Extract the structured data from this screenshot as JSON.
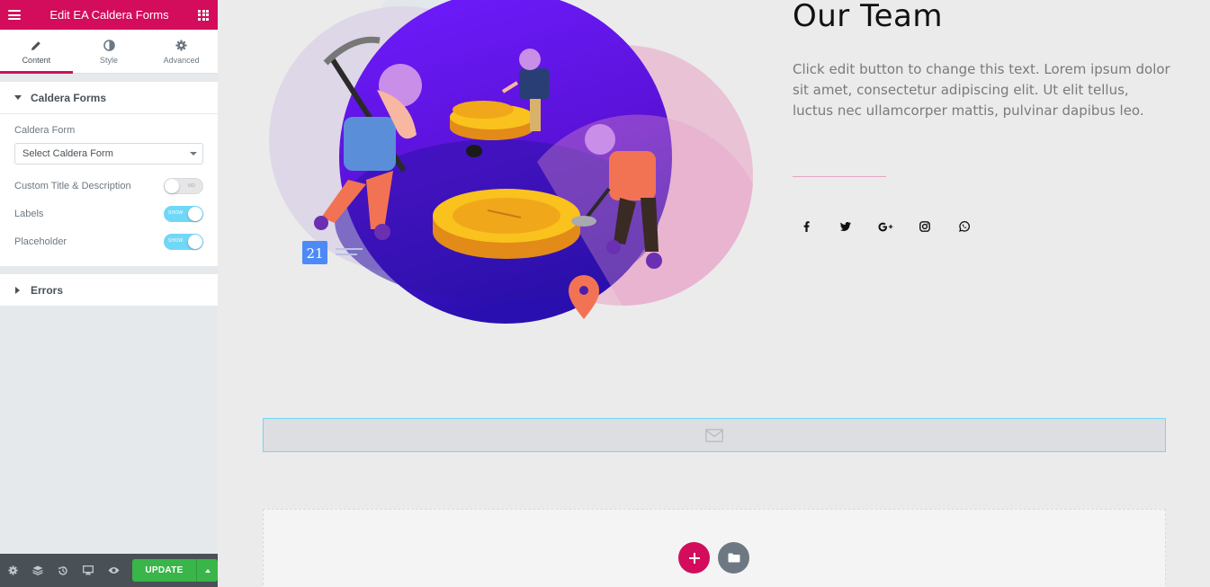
{
  "sidebar": {
    "title": "Edit EA Caldera Forms",
    "tabs": [
      {
        "label": "Content",
        "icon": "pencil-icon"
      },
      {
        "label": "Style",
        "icon": "contrast-icon"
      },
      {
        "label": "Advanced",
        "icon": "gear-icon"
      }
    ],
    "section_caldera": {
      "title": "Caldera Forms",
      "form_label": "Caldera Form",
      "form_select_value": "Select Caldera Form",
      "custom_title_label": "Custom Title & Description",
      "custom_title_toggle": "NO",
      "labels_label": "Labels",
      "labels_toggle": "SHOW",
      "placeholder_label": "Placeholder",
      "placeholder_toggle": "SHOW"
    },
    "section_errors": {
      "title": "Errors"
    },
    "footer": {
      "update_label": "UPDATE"
    }
  },
  "canvas": {
    "team_title": "Our Team",
    "team_text": "Click edit button to change this text. Lorem ipsum dolor sit amet, consectetur adipiscing elit. Ut elit tellus, luctus nec ullamcorper mattis, pulvinar dapibus leo.",
    "socials": [
      "facebook-icon",
      "twitter-icon",
      "google-plus-icon",
      "instagram-icon",
      "whatsapp-icon"
    ],
    "social_glyphs": [
      "f",
      "",
      "G+",
      "",
      ""
    ],
    "illustration_date": "21"
  },
  "colors": {
    "brand": "#d30c5c",
    "update_green": "#39b54a",
    "toggle_on": "#71d7f7"
  }
}
